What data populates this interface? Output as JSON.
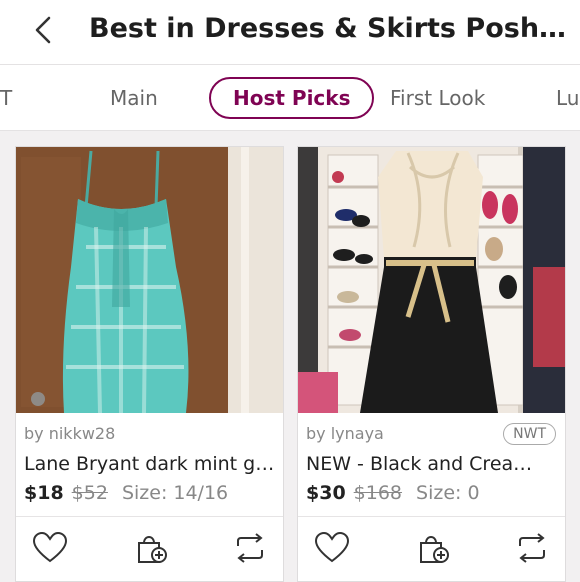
{
  "header": {
    "title": "Best in Dresses & Skirts Posh…"
  },
  "tabs": [
    "T",
    "Main",
    "Host Picks",
    "First Look",
    "Lu"
  ],
  "active_tab": "Host Picks",
  "listings": [
    {
      "seller": "by nikkw28",
      "badge": "",
      "title": "Lane Bryant dark mint g…",
      "price": "$18",
      "original_price": "$52",
      "size": "Size: 14/16"
    },
    {
      "seller": "by lynaya",
      "badge": "NWT",
      "title": "NEW - Black and Crea…",
      "price": "$30",
      "original_price": "$168",
      "size": "Size: 0"
    }
  ],
  "icons": [
    "back-chevron-icon",
    "heart-icon",
    "add-to-bundle-icon",
    "share-icon"
  ],
  "colors": {
    "accent": "#7f0353",
    "background": "#f2f0f1"
  }
}
